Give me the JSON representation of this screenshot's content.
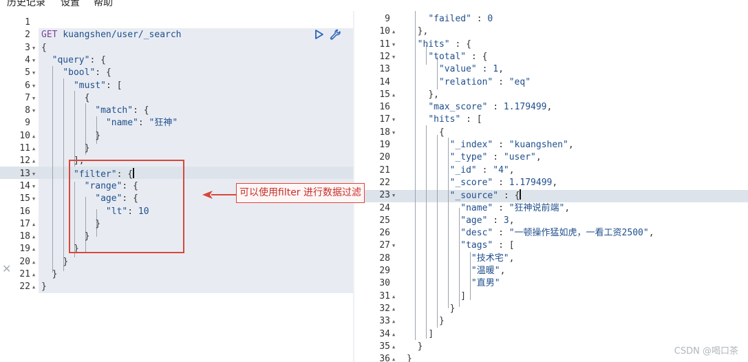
{
  "menu": [
    {
      "label": "历史记录"
    },
    {
      "label": "设置"
    },
    {
      "label": "帮助"
    }
  ],
  "request": {
    "method": "GET",
    "url": "kuangshen/user/_search",
    "lines": [
      {
        "n": "1",
        "fold": false,
        "text": ""
      },
      {
        "n": "2",
        "fold": false,
        "text": "GET kuangshen/user/_search"
      },
      {
        "n": "3",
        "fold": true,
        "text": "{"
      },
      {
        "n": "4",
        "fold": true,
        "text": "  \"query\": {"
      },
      {
        "n": "5",
        "fold": true,
        "text": "    \"bool\": {"
      },
      {
        "n": "6",
        "fold": true,
        "text": "      \"must\": ["
      },
      {
        "n": "7",
        "fold": true,
        "text": "        {"
      },
      {
        "n": "8",
        "fold": true,
        "text": "          \"match\": {"
      },
      {
        "n": "9",
        "fold": false,
        "text": "            \"name\": \"狂神\""
      },
      {
        "n": "10",
        "fold": true,
        "text": "          }"
      },
      {
        "n": "11",
        "fold": true,
        "text": "        }"
      },
      {
        "n": "12",
        "fold": true,
        "text": "      ],"
      },
      {
        "n": "13",
        "fold": true,
        "text": "      \"filter\": {"
      },
      {
        "n": "14",
        "fold": true,
        "text": "        \"range\": {"
      },
      {
        "n": "15",
        "fold": true,
        "text": "          \"age\": {"
      },
      {
        "n": "16",
        "fold": false,
        "text": "            \"lt\": 10"
      },
      {
        "n": "17",
        "fold": true,
        "text": "          }"
      },
      {
        "n": "18",
        "fold": true,
        "text": "        }"
      },
      {
        "n": "19",
        "fold": true,
        "text": "      }"
      },
      {
        "n": "20",
        "fold": true,
        "text": "    }"
      },
      {
        "n": "21",
        "fold": true,
        "text": "  }"
      },
      {
        "n": "22",
        "fold": true,
        "text": "}"
      }
    ]
  },
  "response": {
    "lines": [
      {
        "n": "9",
        "fold": false,
        "text": "    \"failed\" : 0"
      },
      {
        "n": "10",
        "fold": true,
        "text": "  },"
      },
      {
        "n": "11",
        "fold": true,
        "text": "  \"hits\" : {"
      },
      {
        "n": "12",
        "fold": true,
        "text": "    \"total\" : {"
      },
      {
        "n": "13",
        "fold": false,
        "text": "      \"value\" : 1,"
      },
      {
        "n": "14",
        "fold": false,
        "text": "      \"relation\" : \"eq\""
      },
      {
        "n": "15",
        "fold": true,
        "text": "    },"
      },
      {
        "n": "16",
        "fold": false,
        "text": "    \"max_score\" : 1.179499,"
      },
      {
        "n": "17",
        "fold": true,
        "text": "    \"hits\" : ["
      },
      {
        "n": "18",
        "fold": true,
        "text": "      {"
      },
      {
        "n": "19",
        "fold": false,
        "text": "        \"_index\" : \"kuangshen\","
      },
      {
        "n": "20",
        "fold": false,
        "text": "        \"_type\" : \"user\","
      },
      {
        "n": "21",
        "fold": false,
        "text": "        \"_id\" : \"4\","
      },
      {
        "n": "22",
        "fold": false,
        "text": "        \"_score\" : 1.179499,"
      },
      {
        "n": "23",
        "fold": true,
        "text": "        \"_source\" : {"
      },
      {
        "n": "24",
        "fold": false,
        "text": "          \"name\" : \"狂神说前端\","
      },
      {
        "n": "25",
        "fold": false,
        "text": "          \"age\" : 3,"
      },
      {
        "n": "26",
        "fold": false,
        "text": "          \"desc\" : \"一顿操作猛如虎，一看工资2500\","
      },
      {
        "n": "27",
        "fold": true,
        "text": "          \"tags\" : ["
      },
      {
        "n": "28",
        "fold": false,
        "text": "            \"技术宅\","
      },
      {
        "n": "29",
        "fold": false,
        "text": "            \"温暖\","
      },
      {
        "n": "30",
        "fold": false,
        "text": "            \"直男\""
      },
      {
        "n": "31",
        "fold": true,
        "text": "          ]"
      },
      {
        "n": "32",
        "fold": true,
        "text": "        }"
      },
      {
        "n": "33",
        "fold": true,
        "text": "      }"
      },
      {
        "n": "34",
        "fold": true,
        "text": "    ]"
      },
      {
        "n": "35",
        "fold": true,
        "text": "  }"
      },
      {
        "n": "36",
        "fold": true,
        "text": "}"
      }
    ]
  },
  "annotation": {
    "label": "可以使用filter 进行数据过滤",
    "color": "#d9463a"
  },
  "icons": {
    "run": "play-icon",
    "settings": "wrench-icon",
    "close": "close-icon"
  },
  "watermark": "CSDN @喝口茶"
}
